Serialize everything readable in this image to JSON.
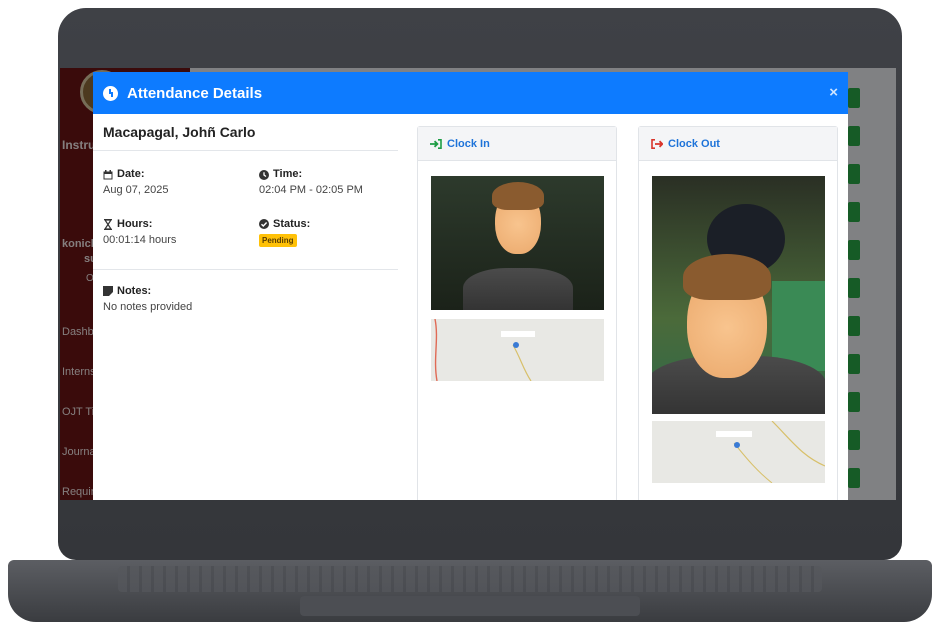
{
  "background_app": {
    "sidebar_texts": [
      "Instru",
      "konich",
      "suma",
      "OJ",
      "Dashb",
      "Interns",
      "OJT Ti",
      "Journa",
      "Requir"
    ]
  },
  "modal": {
    "title": "Attendance Details",
    "close_label": "×",
    "student_name": "Macapagal, Johñ Carlo",
    "date_label": "Date:",
    "date_value": "Aug 07, 2025",
    "time_label": "Time:",
    "time_value": "02:04 PM - 02:05 PM",
    "hours_label": "Hours:",
    "hours_value": "00:01:14 hours",
    "status_label": "Status:",
    "status_value": "Pending",
    "notes_label": "Notes:",
    "notes_value": "No notes provided",
    "clock_in": {
      "title": "Clock In",
      "color": "#1e9e46"
    },
    "clock_out": {
      "title": "Clock Out",
      "color": "#d9352b"
    },
    "header_color": "#0d7bff",
    "status_color": "#ffc107"
  },
  "icons": [
    "clock-icon",
    "calendar-icon",
    "hourglass-icon",
    "check-circle-icon",
    "sticky-note-icon",
    "sign-in-icon",
    "sign-out-icon",
    "map-pin-icon",
    "close-icon"
  ]
}
